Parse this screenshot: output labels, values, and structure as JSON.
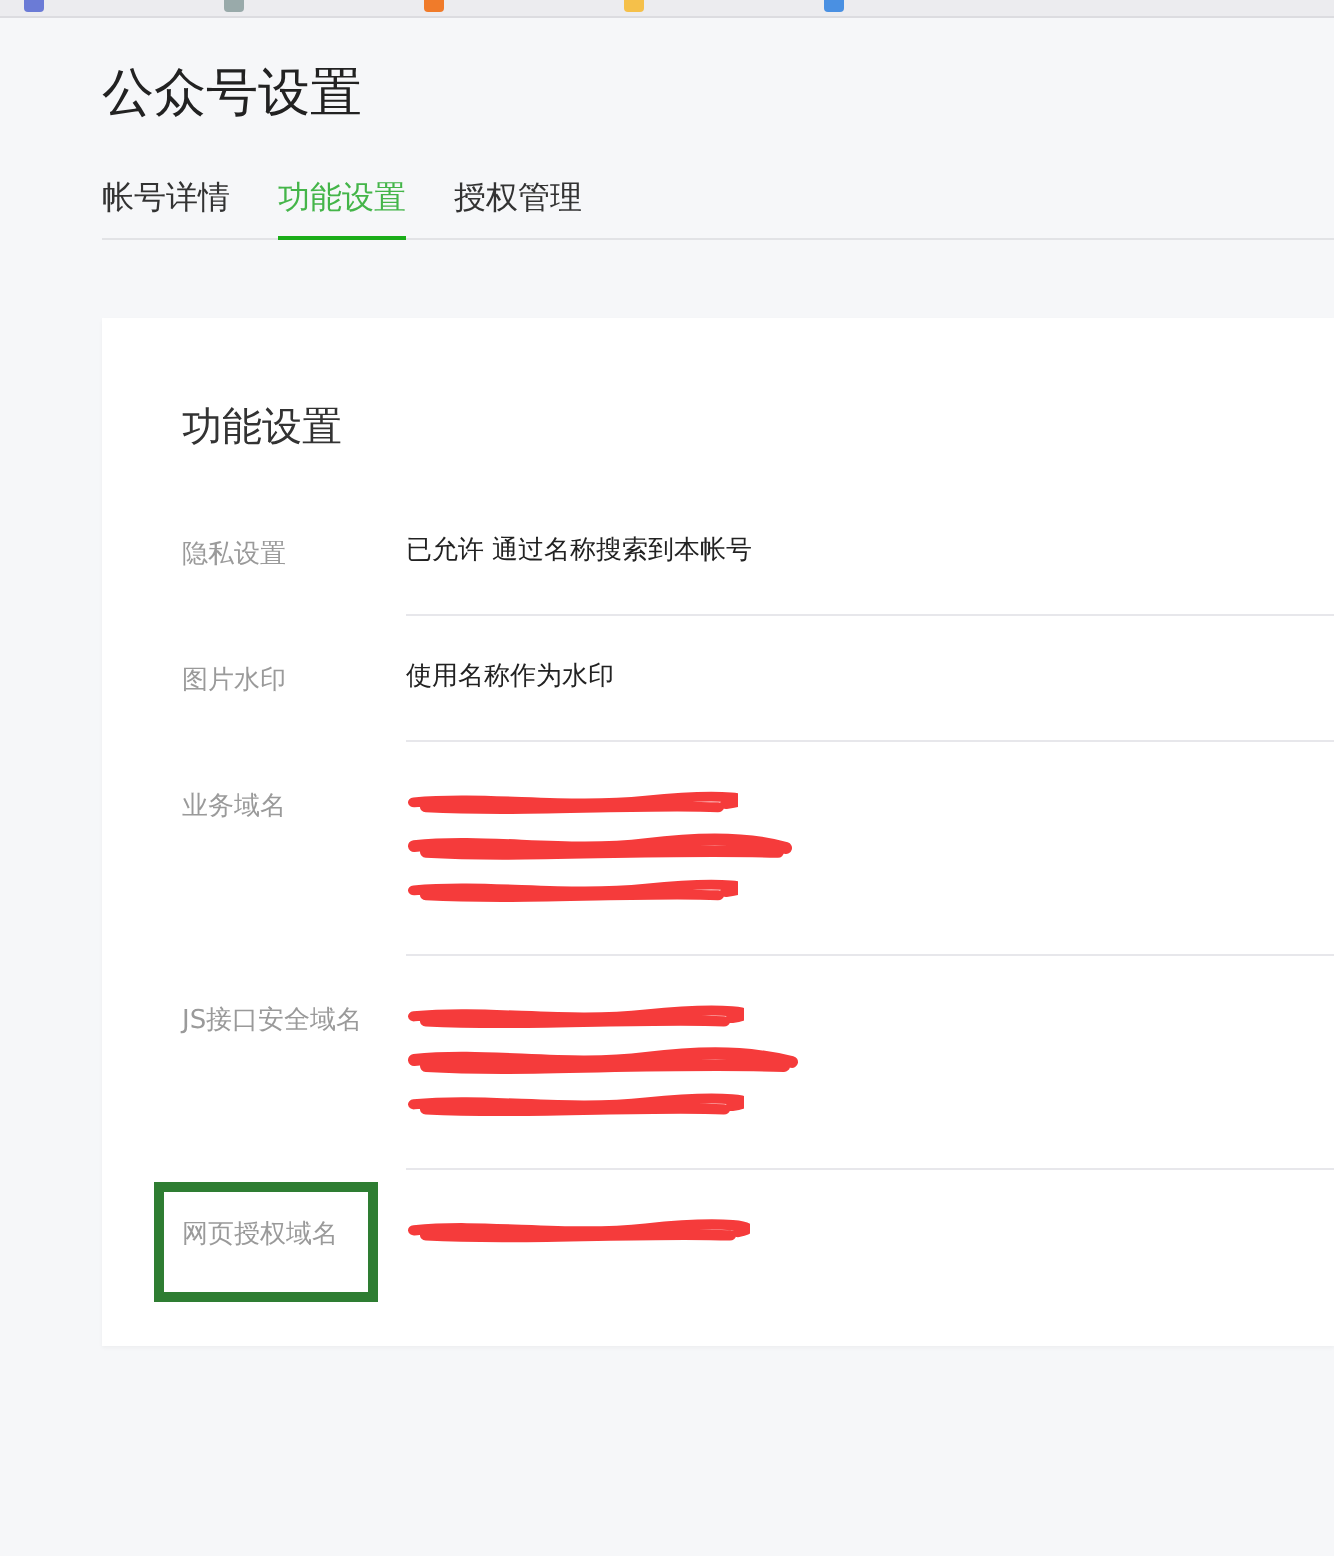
{
  "page": {
    "title": "公众号设置"
  },
  "tabs": [
    {
      "label": "帐号详情",
      "selected": false
    },
    {
      "label": "功能设置",
      "selected": true
    },
    {
      "label": "授权管理",
      "selected": false
    }
  ],
  "card": {
    "title": "功能设置",
    "rows": [
      {
        "label": "隐私设置",
        "highlighted": false,
        "values": [
          {
            "kind": "text",
            "text": "已允许 通过名称搜索到本帐号"
          }
        ]
      },
      {
        "label": "图片水印",
        "highlighted": false,
        "values": [
          {
            "kind": "text",
            "text": "使用名称作为水印"
          }
        ]
      },
      {
        "label": "业务域名",
        "highlighted": false,
        "values": [
          {
            "kind": "redacted"
          },
          {
            "kind": "redacted"
          },
          {
            "kind": "redacted"
          }
        ]
      },
      {
        "label": "JS接口安全域名",
        "highlighted": false,
        "values": [
          {
            "kind": "redacted"
          },
          {
            "kind": "redacted"
          },
          {
            "kind": "redacted"
          }
        ]
      },
      {
        "label": "网页授权域名",
        "highlighted": true,
        "values": [
          {
            "kind": "redacted"
          }
        ]
      }
    ]
  }
}
